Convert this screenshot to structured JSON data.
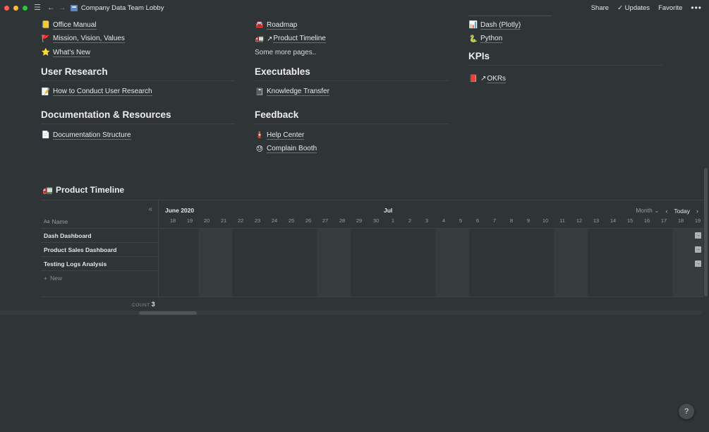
{
  "window": {
    "title": "Company Data Team Lobby"
  },
  "toolbar": {
    "share": "Share",
    "updates": "Updates",
    "favorite": "Favorite",
    "more": "•••"
  },
  "col1": {
    "items": [
      {
        "icon": "📒",
        "label": "Office Manual"
      },
      {
        "icon": "🚩",
        "label": "Mission, Vision, Values"
      },
      {
        "icon": "⭐",
        "label": "What's New"
      }
    ],
    "user_research": {
      "heading": "User Research",
      "items": [
        {
          "icon": "📝",
          "label": "How to Conduct User Research"
        }
      ]
    },
    "docs": {
      "heading": "Documentation & Resources",
      "items": [
        {
          "icon": "📄",
          "label": "Documentation Structure"
        }
      ]
    }
  },
  "col2": {
    "items": [
      {
        "icon": "🚘",
        "label": "Roadmap"
      },
      {
        "icon": "🚛",
        "label": "Product Timeline"
      },
      {
        "label": "Some more pages.."
      }
    ],
    "executables": {
      "heading": "Executables",
      "items": [
        {
          "icon": "📓",
          "label": "Knowledge Transfer"
        }
      ]
    },
    "feedback": {
      "heading": "Feedback",
      "items": [
        {
          "icon": "🧯",
          "label": "Help Center"
        },
        {
          "icon": "😓",
          "label": "Complain Booth"
        }
      ]
    }
  },
  "col3": {
    "items": [
      {
        "icon": "📊",
        "label": "Dash (Plotly)"
      },
      {
        "icon": "🐍",
        "label": "Python"
      }
    ],
    "kpis": {
      "heading": "KPIs",
      "items": [
        {
          "icon": "📕",
          "label": "OKRs"
        }
      ]
    }
  },
  "timeline": {
    "title": "Product Timeline",
    "icon": "🚛",
    "name_header": "Name",
    "rows": [
      "Dash Dashboard",
      "Product Sales Dashboard",
      "Testing Logs Analysis"
    ],
    "new_label": "New",
    "months": [
      "June 2020",
      "Jul"
    ],
    "days": [
      "18",
      "19",
      "20",
      "21",
      "22",
      "23",
      "24",
      "25",
      "26",
      "27",
      "28",
      "29",
      "30",
      "1",
      "2",
      "3",
      "4",
      "5",
      "6",
      "7",
      "8",
      "9",
      "10",
      "11",
      "12",
      "13",
      "14",
      "15",
      "16",
      "17",
      "18",
      "19"
    ],
    "view": "Month",
    "today": "Today",
    "count_label": "COUNT",
    "count_value": "3"
  },
  "help": "?"
}
